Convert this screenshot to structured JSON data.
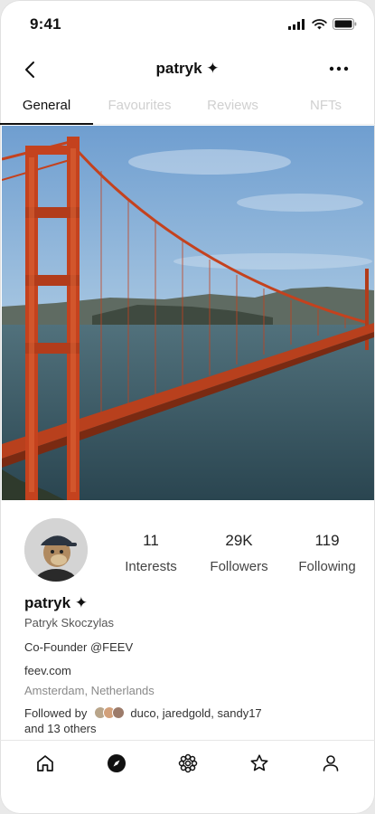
{
  "status_bar": {
    "time": "9:41",
    "icons": [
      "signal-icon",
      "wifi-icon",
      "battery-icon"
    ]
  },
  "header": {
    "title": "patryk ✦",
    "back_icon": "chevron-left-icon",
    "more_icon": "more-horizontal-icon"
  },
  "tabs": [
    {
      "label": "General",
      "active": true
    },
    {
      "label": "Favourites",
      "active": false
    },
    {
      "label": "Reviews",
      "active": false
    },
    {
      "label": "NFTs",
      "active": false
    }
  ],
  "profile": {
    "stats": [
      {
        "value": "11",
        "label": "Interests"
      },
      {
        "value": "29K",
        "label": "Followers"
      },
      {
        "value": "119",
        "label": "Following"
      }
    ],
    "username": "patryk ✦",
    "full_name": "Patryk Skoczylas",
    "bio": "Co-Founder @FEEV",
    "website": "feev.com",
    "location": "Amsterdam, Netherlands",
    "followed_by_prefix": "Followed by",
    "followed_by_names": "duco, jaredgold, sandy17",
    "followed_by_others": "and 13 others"
  },
  "bottom_nav": [
    {
      "icon": "home-icon",
      "active": false
    },
    {
      "icon": "compass-icon",
      "active": true
    },
    {
      "icon": "grid-flower-icon",
      "active": false
    },
    {
      "icon": "star-icon",
      "active": false
    },
    {
      "icon": "profile-icon",
      "active": false
    }
  ],
  "colors": {
    "bridge": "#c4421e",
    "sky_top": "#6f9ed0",
    "water": "#3b5b66",
    "text_muted": "#8a8a8a"
  }
}
